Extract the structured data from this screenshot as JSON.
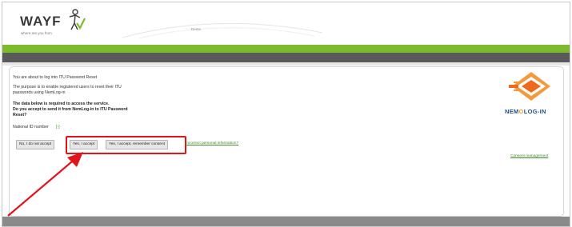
{
  "header": {
    "brand": "WAYF",
    "tagline": "where are you from",
    "center_text": "Demo"
  },
  "content": {
    "intro": "You are about to log into ITU Password Reset",
    "purpose_line1": "The purpose is to enable registered users to reset their ITU",
    "purpose_line2": "passwords using NemLog-in",
    "question_line1": "The data below is required to access the service.",
    "question_line2": "Do you accept to send it from NemLog-in to ITU Password",
    "question_line3": "Reset?",
    "attribute_label": "National ID number",
    "attribute_toggle": "[-]"
  },
  "buttons": {
    "decline": "No, I do not accept",
    "accept": "Yes, I accept",
    "accept_remember": "Yes, I accept, remember consent"
  },
  "links": {
    "incorrect_info": "Incorrect personal information?",
    "consent_management": "Consent management"
  },
  "idp": {
    "logo_text_prefix": "NEM",
    "logo_text_o": "O",
    "logo_text_suffix": "LOG-IN"
  },
  "colors": {
    "green_bar": "#7dbb2e",
    "dark_bar": "#5a5a5a",
    "highlight": "#e0141b",
    "link": "#3d8a2a",
    "nem_blue": "#1f4f8a",
    "nem_orange": "#f0a030"
  },
  "icons": [
    "wayf-logo-icon",
    "nemlogin-icon",
    "annotation-arrow-icon"
  ]
}
